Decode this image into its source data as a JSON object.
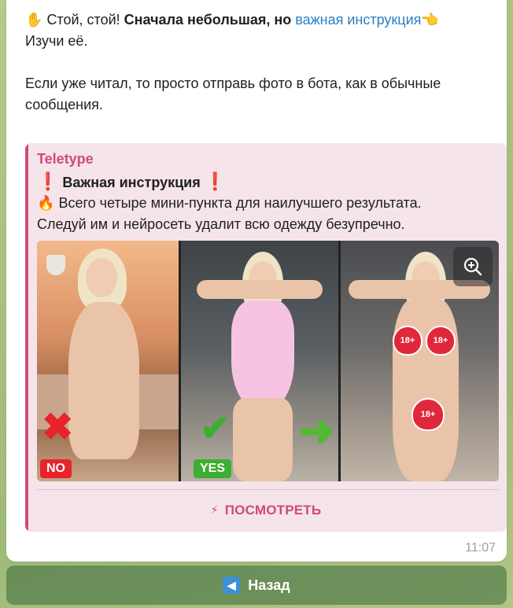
{
  "message": {
    "line1_prefix": "Стой, стой!",
    "line1_bold": "Сначала небольшая, но",
    "line1_link": "важная инструкция",
    "line2": "Изучи её.",
    "line3": "Если уже читал, то просто отправь фото в бота, как в обычные",
    "line4": "сообщения.",
    "emoji_hand": "✋",
    "emoji_point": "👈"
  },
  "preview": {
    "site_name": "Teletype",
    "title": "Важная инструкция",
    "title_mark": "❗",
    "desc_line1": "Всего четыре мини-пункта для наилучшего результата.",
    "desc_line2": "Следуй им и нейросеть удалит всю одежду безупречно.",
    "fire": "🔥",
    "image": {
      "label_no": "NO",
      "label_yes": "YES",
      "sticker_text": "18+"
    },
    "view_button": "ПОСМОТРЕТЬ",
    "view_icon": "⚡"
  },
  "timestamp": "11:07",
  "back_button": {
    "label": "Назад",
    "icon": "◀"
  },
  "colors": {
    "accent": "#d04a7a",
    "link": "#2a7fc3",
    "no_red": "#e8232a",
    "yes_green": "#3cae32"
  }
}
